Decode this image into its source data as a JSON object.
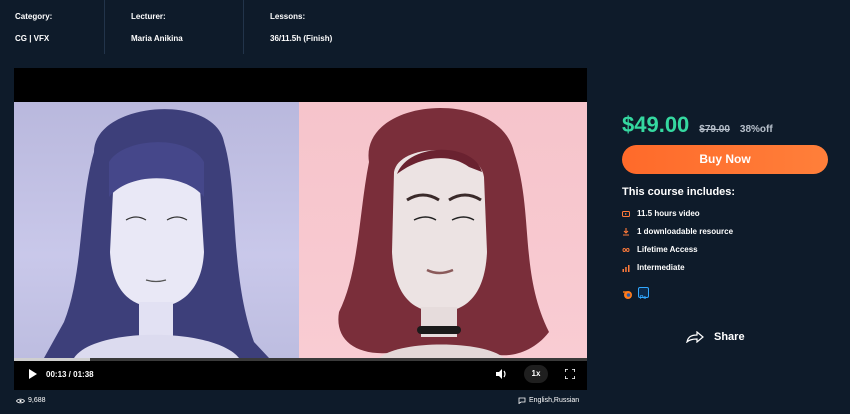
{
  "meta": {
    "category_label": "Category:",
    "category_value": "CG | VFX",
    "lecturer_label": "Lecturer:",
    "lecturer_value": "Maria Anikina",
    "lessons_label": "Lessons:",
    "lessons_value": "36/11.5h (Finish)"
  },
  "player": {
    "time": "00:13 / 01:38",
    "speed": "1x",
    "progress": 0.133,
    "play_icon": "play-icon",
    "volume_icon": "volume-icon",
    "fullscreen_icon": "fullscreen-icon"
  },
  "pricing": {
    "price": "$49.00",
    "old_price": "$79.00",
    "discount": "38%off",
    "price_color": "#35d8a0"
  },
  "buy_button": {
    "label": "Buy Now",
    "color": "#ff6a2a"
  },
  "includes": {
    "title": "This course includes:",
    "items": [
      {
        "icon": "video-icon",
        "label": "11.5 hours video"
      },
      {
        "icon": "download-icon",
        "label": "1 downloadable resource"
      },
      {
        "icon": "infinity-icon",
        "label": "Lifetime Access"
      },
      {
        "icon": "level-icon",
        "label": "Intermediate"
      }
    ]
  },
  "tools": [
    "blender-icon",
    "photoshop-icon"
  ],
  "share": {
    "label": "Share",
    "icon": "share-icon"
  },
  "footer": {
    "views": "9,688",
    "languages": "English,Russian"
  }
}
